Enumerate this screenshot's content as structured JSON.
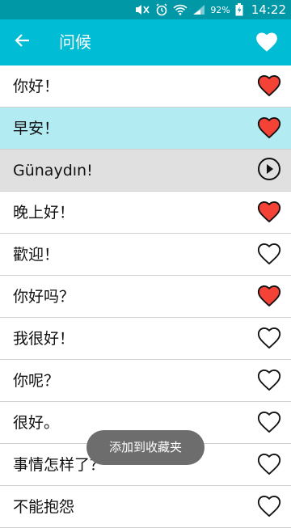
{
  "status": {
    "battery": "92%",
    "time": "14:22"
  },
  "app_bar": {
    "title": "问候"
  },
  "items": [
    {
      "text": "你好！",
      "state": "favorite"
    },
    {
      "text": "早安！",
      "state": "favorite"
    },
    {
      "text": "Günaydın!",
      "state": "play"
    },
    {
      "text": "晚上好！",
      "state": "favorite"
    },
    {
      "text": "歡迎！",
      "state": "outline"
    },
    {
      "text": "你好吗？",
      "state": "favorite"
    },
    {
      "text": "我很好！",
      "state": "outline"
    },
    {
      "text": "你呢？",
      "state": "outline"
    },
    {
      "text": "很好。",
      "state": "outline"
    },
    {
      "text": "事情怎样了？",
      "state": "outline"
    },
    {
      "text": "不能抱怨",
      "state": "outline"
    }
  ],
  "toast": {
    "text": "添加到收藏夹"
  },
  "colors": {
    "status_bar": "#0097a7",
    "app_bar": "#00bcd4",
    "heart_red": "#f44336",
    "highlight": "#b2ebf2",
    "playing": "#e0e0e0"
  }
}
